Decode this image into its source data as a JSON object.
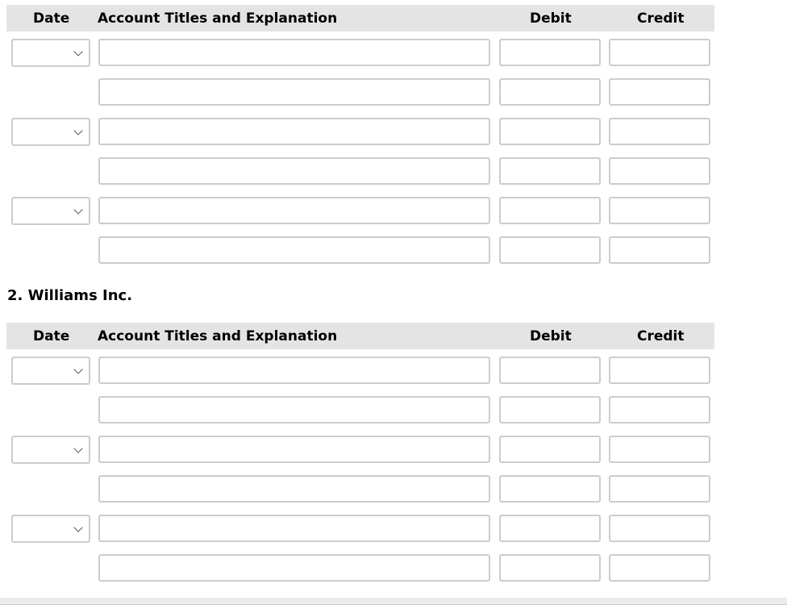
{
  "columns": {
    "date": "Date",
    "account": "Account Titles and Explanation",
    "debit": "Debit",
    "credit": "Credit"
  },
  "sections": [
    {
      "title": "",
      "entries": [
        {
          "date": "",
          "lines": [
            {
              "account": "",
              "debit": "",
              "credit": ""
            },
            {
              "account": "",
              "debit": "",
              "credit": ""
            }
          ]
        },
        {
          "date": "",
          "lines": [
            {
              "account": "",
              "debit": "",
              "credit": ""
            },
            {
              "account": "",
              "debit": "",
              "credit": ""
            }
          ]
        },
        {
          "date": "",
          "lines": [
            {
              "account": "",
              "debit": "",
              "credit": ""
            },
            {
              "account": "",
              "debit": "",
              "credit": ""
            }
          ]
        }
      ]
    },
    {
      "title": "2. Williams Inc.",
      "entries": [
        {
          "date": "",
          "lines": [
            {
              "account": "",
              "debit": "",
              "credit": ""
            },
            {
              "account": "",
              "debit": "",
              "credit": ""
            }
          ]
        },
        {
          "date": "",
          "lines": [
            {
              "account": "",
              "debit": "",
              "credit": ""
            },
            {
              "account": "",
              "debit": "",
              "credit": ""
            }
          ]
        },
        {
          "date": "",
          "lines": [
            {
              "account": "",
              "debit": "",
              "credit": ""
            },
            {
              "account": "",
              "debit": "",
              "credit": ""
            }
          ]
        }
      ]
    }
  ]
}
